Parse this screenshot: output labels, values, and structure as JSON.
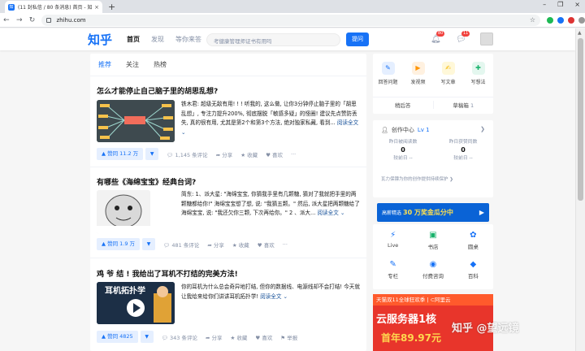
{
  "browser": {
    "tab_title": "(11 封私信 / 80 条消息) 首页 - 知乎",
    "tab_close": "×",
    "new_tab": "+",
    "window_controls": [
      "–",
      "❐",
      "×"
    ],
    "url": "zhihu.com"
  },
  "header": {
    "logo": "知乎",
    "nav": [
      "首页",
      "发现",
      "等你来答"
    ],
    "search_placeholder": "考健康管理师证书有用吗",
    "ask_label": "提问",
    "notif_badge": "80",
    "msg_badge": "11"
  },
  "feed_tabs": [
    "推荐",
    "关注",
    "热榜"
  ],
  "cards": [
    {
      "title": "怎么才能停止自己脑子里的胡思乱想?",
      "excerpt": "铁木君: 超级无敌有用! ! ! 听我的, 这么做, 让你3分钟停止脑子里的「胡思乱想」, 专注力提升200%, 彻底摆脱「敏感多疑」的怪圈! 建议先点赞防丢失, 真的很有用, 尤其是第2个和第3个方法, 绝对独家私藏, 看到...",
      "more": "阅读全文 ⌄",
      "vote": "▲ 赞同 11.2 万",
      "comments": "1,145 条评论",
      "share": "分享",
      "fav": "收藏",
      "like": "喜欢",
      "dots": "···"
    },
    {
      "title": "有哪些《海绵宝宝》经典台词?",
      "excerpt": "简东: 1、派大星: \"海绵宝宝, 你猜我手里有几颗糖, 猜对了我就把手里的两颗糖都给你!\" 海绵宝宝想了想, 说: \"我猜五颗。\" 然后, 派大星把两颗糖给了海绵宝宝, 说: \"我还欠你三颗, 下次再给你。\" 2 、派大...",
      "more": "阅读全文 ⌄",
      "vote": "▲ 赞同 1.9 万",
      "comments": "481 条评论",
      "share": "分享",
      "fav": "收藏",
      "like": "喜欢",
      "dots": "···"
    },
    {
      "title": "鸡 爷 结 ! 我给出了耳机不打结的完美方法!",
      "thumb_text": "耳机拓扑学",
      "excerpt": "你的耳机为什么总会奇异地打结, 但你的数据线、电源线却不会打结! 今天就让我给来给你们讲讲耳机拓扑学!",
      "more": "阅读全文 ⌄",
      "vote": "▲ 赞同 4825",
      "comments": "343 条评论",
      "share": "分享",
      "fav": "收藏",
      "like": "喜欢",
      "report": "举报"
    }
  ],
  "creator_tools": [
    {
      "label": "回答问题",
      "color": "#e5efff",
      "fg": "#1772f6",
      "icon": "✎"
    },
    {
      "label": "发视频",
      "color": "#fff1e0",
      "fg": "#ff9607",
      "icon": "▶"
    },
    {
      "label": "写文章",
      "color": "#fff8d9",
      "fg": "#f5b700",
      "icon": "✍"
    },
    {
      "label": "写想法",
      "color": "#e4f7ef",
      "fg": "#18b26b",
      "icon": "✚"
    }
  ],
  "drafts": {
    "answers": "稍后答",
    "drafts": "草稿箱",
    "draft_count": "1"
  },
  "creator_center": {
    "title": "创作中心",
    "level": "Lv 1",
    "stat1_label": "昨日被阅读数",
    "stat1_value": "0",
    "stat1_sub": "较前日 --",
    "stat2_label": "昨日获赞同数",
    "stat2_value": "0",
    "stat2_sub": "较前日 --",
    "note": "瓦力保镖为你的创作提供持续保护 ❯"
  },
  "banner": {
    "pre": "高薪精选",
    "amount": "30 万奖金瓜分中",
    "suffix": "▶"
  },
  "tools": [
    {
      "label": "Live",
      "icon": "⚡",
      "color": "#1772f6"
    },
    {
      "label": "书店",
      "icon": "▣",
      "color": "#18b26b"
    },
    {
      "label": "圆桌",
      "icon": "✿",
      "color": "#1772f6"
    },
    {
      "label": "专栏",
      "icon": "✎",
      "color": "#1772f6"
    },
    {
      "label": "付费咨询",
      "icon": "◉",
      "color": "#1772f6"
    },
    {
      "label": "百科",
      "icon": "◆",
      "color": "#1772f6"
    }
  ],
  "ad": {
    "top": "天猫双11全球狂欢季 | ⊂阿里云",
    "main": "云服务器1核",
    "sub": "首年89.97元"
  },
  "watermark": "知乎 @望远镜"
}
